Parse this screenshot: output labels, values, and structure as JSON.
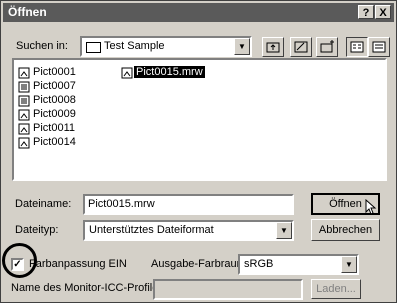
{
  "window": {
    "title": "Öffnen",
    "help_glyph": "?",
    "close_glyph": "X"
  },
  "lookin": {
    "label": "Suchen in:",
    "value": "Test Sample"
  },
  "toolbar": {
    "icons": [
      "up-folder-icon",
      "desktop-icon",
      "new-folder-icon",
      "list-view-icon",
      "details-view-icon"
    ]
  },
  "files": {
    "col1": [
      "Pict0001",
      "Pict0007",
      "Pict0008",
      "Pict0009",
      "Pict0011",
      "Pict0014"
    ],
    "col2": [
      "Pict0015.mrw"
    ]
  },
  "filename": {
    "label": "Dateiname:",
    "value": "Pict0015.mrw"
  },
  "filetype": {
    "label": "Dateityp:",
    "value": "Unterstütztes Dateiformat"
  },
  "buttons": {
    "open": "Öffnen",
    "cancel": "Abbrechen",
    "load": "Laden..."
  },
  "colormatch": {
    "label": "Farbanpassung EIN",
    "checked": true
  },
  "output_space": {
    "label": "Ausgabe-Farbraum",
    "value": "sRGB"
  },
  "monitor_icc": {
    "label": "Name des Monitor-ICC-Profiles",
    "value": ""
  }
}
